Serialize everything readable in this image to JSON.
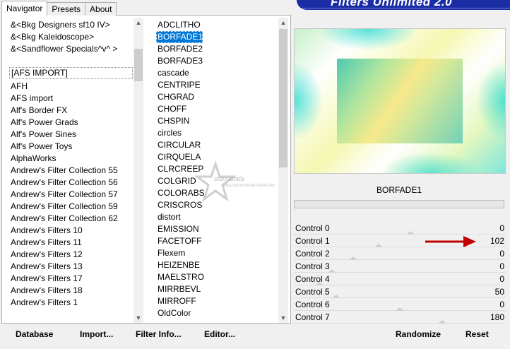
{
  "tabs": [
    {
      "label": "Navigator",
      "active": true
    },
    {
      "label": "Presets",
      "active": false
    },
    {
      "label": "About",
      "active": false
    }
  ],
  "banner_title": "Filters Unlimited 2.0",
  "categories": [
    "&<Bkg Designers sf10 IV>",
    "&<Bkg Kaleidoscope>",
    "&<Sandflower Specials^v^ >",
    "",
    "[AFS IMPORT]",
    "AFH",
    "AFS import",
    "Alf's Border FX",
    "Alf's Power Grads",
    "Alf's Power Sines",
    "Alf's Power Toys",
    "AlphaWorks",
    "Andrew's Filter Collection 55",
    "Andrew's Filter Collection 56",
    "Andrew's Filter Collection 57",
    "Andrew's Filter Collection 59",
    "Andrew's Filter Collection 62",
    "Andrew's Filters 10",
    "Andrew's Filters 11",
    "Andrew's Filters 12",
    "Andrew's Filters 13",
    "Andrew's Filters 17",
    "Andrew's Filters 18",
    "Andrew's Filters 1"
  ],
  "focused_category": "[AFS IMPORT]",
  "filters": [
    "ADCLITHO",
    "BORFADE1",
    "BORFADE2",
    "BORFADE3",
    "cascade",
    "CENTRIPE",
    "CHGRAD",
    "CHOFF",
    "CHSPIN",
    "circles",
    "CIRCULAR",
    "CIRQUELA",
    "CLRCREEP",
    "COLGRID",
    "COLORABS",
    "CRISCROS",
    "distort",
    "EMISSION",
    "FACETOFF",
    "Flexem",
    "HEIZENBE",
    "MAELSTRO",
    "MIRRBEVL",
    "MIRROFF",
    "OldColor"
  ],
  "selected_filter": "BORFADE1",
  "preview_label": "BORFADE1",
  "watermark": {
    "line1": "stormonda",
    "line2": "https://stormonda-inside.de/"
  },
  "controls": [
    {
      "label": "Control 0",
      "value": 0
    },
    {
      "label": "Control 1",
      "value": 102
    },
    {
      "label": "Control 2",
      "value": 0
    },
    {
      "label": "Control 3",
      "value": 0
    },
    {
      "label": "Control 4",
      "value": 0
    },
    {
      "label": "Control 5",
      "value": 50
    },
    {
      "label": "Control 6",
      "value": 0
    },
    {
      "label": "Control 7",
      "value": 180
    }
  ],
  "buttons": {
    "database": "Database",
    "import": "Import...",
    "filter_info": "Filter Info...",
    "editor": "Editor...",
    "randomize": "Randomize",
    "reset": "Reset"
  },
  "colors": {
    "accent": "#0078d7",
    "banner": "#1b2da5",
    "arrow": "#c00000"
  }
}
